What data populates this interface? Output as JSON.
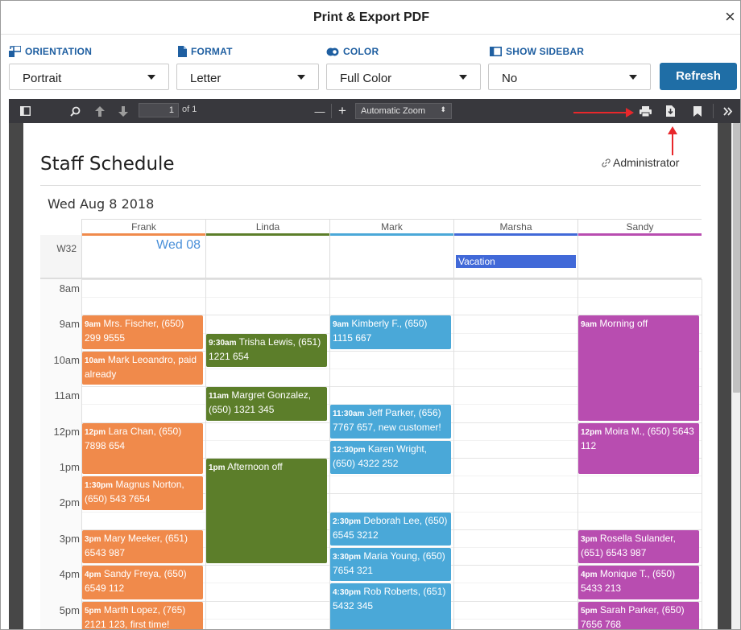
{
  "dialog": {
    "title": "Print & Export PDF",
    "close_glyph": "×"
  },
  "options": {
    "orientation": {
      "label": "ORIENTATION",
      "value": "Portrait"
    },
    "format": {
      "label": "FORMAT",
      "value": "Letter"
    },
    "color": {
      "label": "COLOR",
      "value": "Full Color"
    },
    "sidebar": {
      "label": "SHOW SIDEBAR",
      "value": "No"
    },
    "refresh_label": "Refresh"
  },
  "viewer": {
    "page_number": "1",
    "page_of": "of 1",
    "zoom": "Automatic Zoom",
    "zoom_caret": "⬍",
    "zoom_out": "—",
    "zoom_in": "+"
  },
  "schedule": {
    "title": "Staff Schedule",
    "admin": "Administrator",
    "date": "Wed Aug 8 2018",
    "week": "W32",
    "day_label": "Wed 08",
    "allday_event": "Vacation",
    "columns": [
      {
        "name": "Frank",
        "color": "#f08a4b"
      },
      {
        "name": "Linda",
        "color": "#5c7e2a"
      },
      {
        "name": "Mark",
        "color": "#4aa8d8"
      },
      {
        "name": "Marsha",
        "color": "#4169d8"
      },
      {
        "name": "Sandy",
        "color": "#b84db0"
      }
    ],
    "times": [
      "8am",
      "9am",
      "10am",
      "11am",
      "12pm",
      "1pm",
      "2pm",
      "3pm",
      "4pm",
      "5pm"
    ],
    "events": {
      "frank": [
        {
          "time": "9am",
          "text": "Mrs. Fischer, (650) 299 9555"
        },
        {
          "time": "10am",
          "text": "Mark Leoandro, paid already"
        },
        {
          "time": "12pm",
          "text": "Lara Chan, (650) 7898 654"
        },
        {
          "time": "1:30pm",
          "text": "Magnus Norton, (650) 543 7654"
        },
        {
          "time": "3pm",
          "text": "Mary Meeker, (651) 6543 987"
        },
        {
          "time": "4pm",
          "text": "Sandy Freya, (650) 6549 112"
        },
        {
          "time": "5pm",
          "text": "Marth Lopez, (765) 2121 123, first time!"
        }
      ],
      "linda": [
        {
          "time": "9:30am",
          "text": "Trisha Lewis, (651) 1221 654"
        },
        {
          "time": "11am",
          "text": "Margret Gonzalez, (650) 1321 345"
        },
        {
          "time": "1pm",
          "text": "Afternoon off"
        }
      ],
      "mark": [
        {
          "time": "9am",
          "text": "Kimberly F., (650) 1115 667"
        },
        {
          "time": "11:30am",
          "text": "Jeff Parker, (656) 7767 657, new customer!"
        },
        {
          "time": "12:30pm",
          "text": "Karen Wright, (650) 4322 252"
        },
        {
          "time": "2:30pm",
          "text": "Deborah Lee, (650) 6545 3212"
        },
        {
          "time": "3:30pm",
          "text": "Maria Young, (650) 7654 321"
        },
        {
          "time": "4:30pm",
          "text": "Rob Roberts, (651) 5432 345"
        }
      ],
      "sandy": [
        {
          "time": "9am",
          "text": "Morning off"
        },
        {
          "time": "12pm",
          "text": "Moira M., (650) 5643 112"
        },
        {
          "time": "3pm",
          "text": "Rosella Sulander, (651) 6543 987"
        },
        {
          "time": "4pm",
          "text": "Monique T., (650) 5433 213"
        },
        {
          "time": "5pm",
          "text": "Sarah Parker, (650) 7656 768"
        }
      ]
    }
  },
  "colors": {
    "accent": "#1f6ea6",
    "toolbar": "#38383d",
    "annotation_arrow": "#e8272b"
  }
}
